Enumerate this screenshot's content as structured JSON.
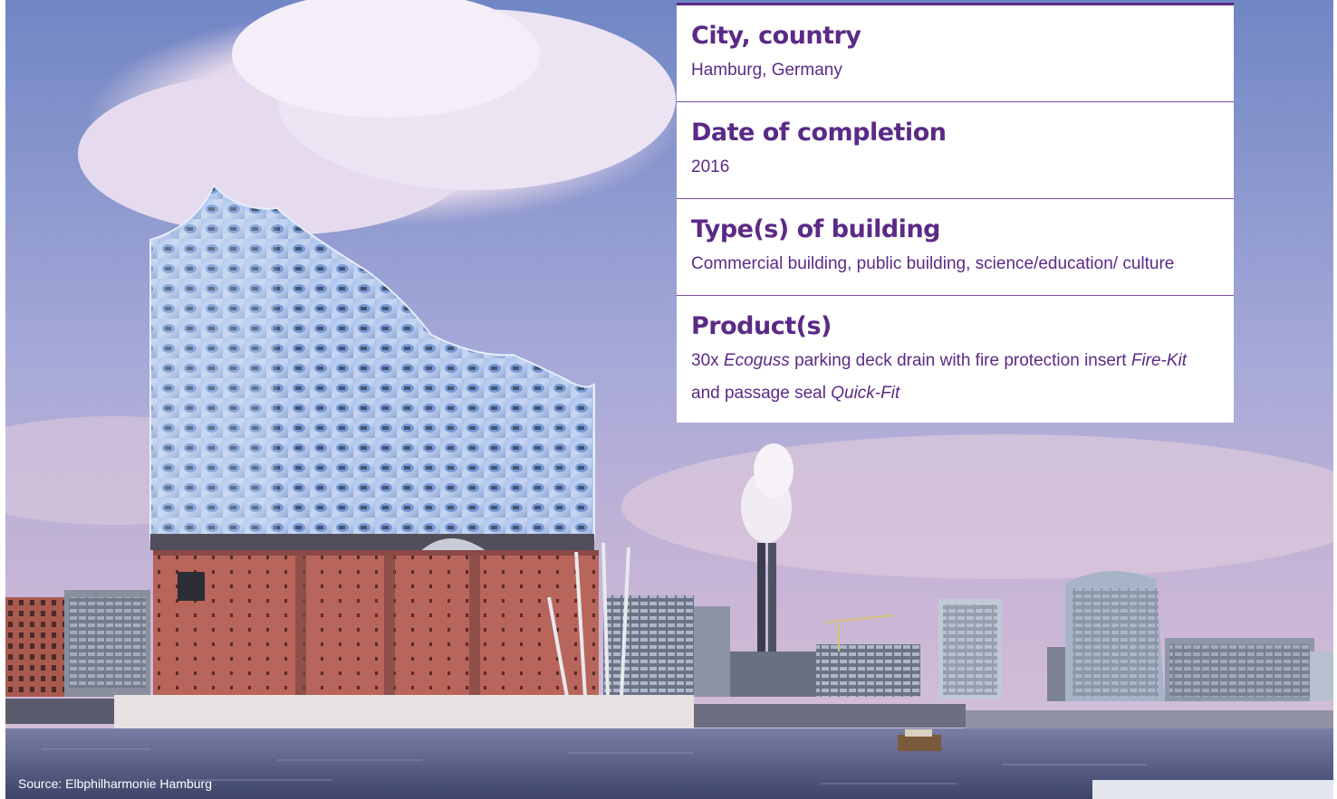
{
  "info": {
    "city_heading": "City, country",
    "city_value": "Hamburg, Germany",
    "date_heading": "Date of completion",
    "date_value": "2016",
    "type_heading": "Type(s) of building",
    "type_value": "Commercial building, public building, science/education/ culture",
    "product_heading": "Product(s)",
    "product_text_1": "30x ",
    "product_em_1": "Ecoguss",
    "product_text_2": " parking deck drain with fire protection insert ",
    "product_em_2": "Fire-Kit",
    "product_text_3": " and passage seal ",
    "product_em_3": "Quick-Fit"
  },
  "caption": {
    "source": "Source: Elbphilharmonie Hamburg"
  },
  "photo": {
    "subject": "Elbphilharmonie concert hall on the Elbe river, Hamburg skyline",
    "colors": {
      "sky_top": "#7a8fc8",
      "sky_bottom": "#cdb9d6",
      "cloud": "#e8dff0",
      "glass": "#9fb6e2",
      "brick": "#b5645c",
      "water": "#5a5f86",
      "text_purple": "#5b2a86"
    }
  }
}
